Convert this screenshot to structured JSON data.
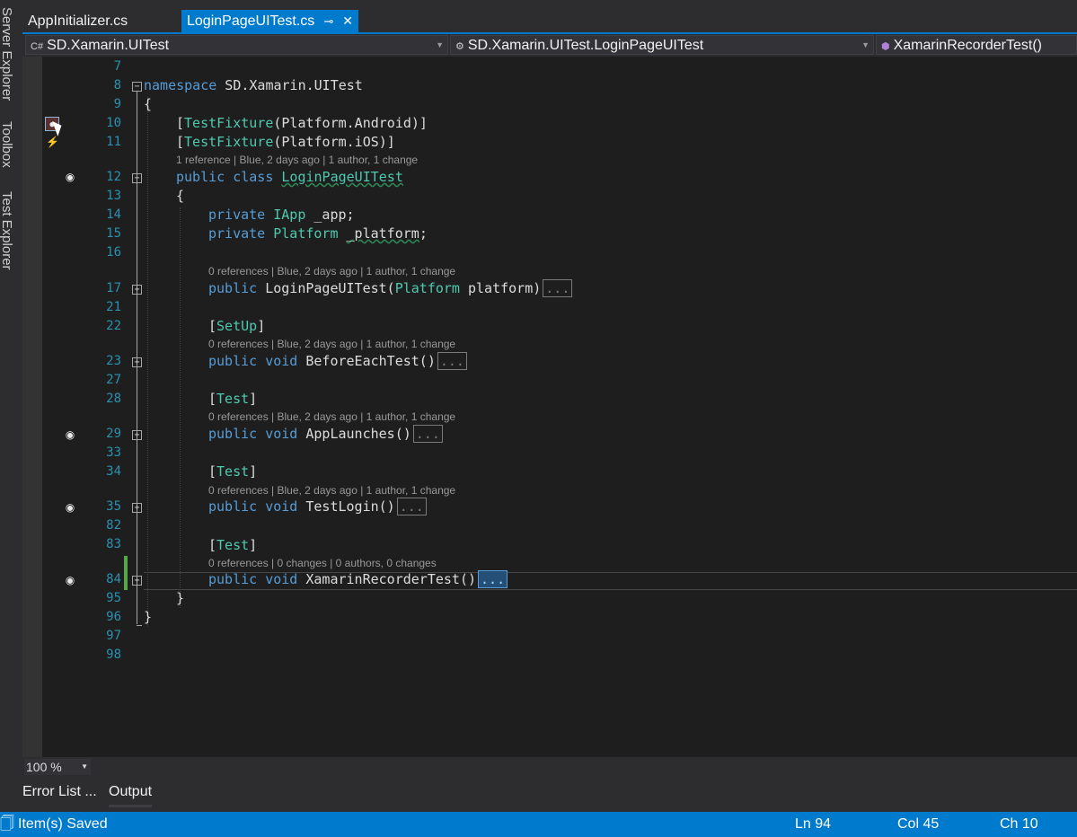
{
  "side_panels": [
    "Server Explorer",
    "Toolbox",
    "Test Explorer"
  ],
  "tabs": [
    {
      "label": "AppInitializer.cs"
    },
    {
      "label": "LoginPageUITest.cs",
      "pin": "⊸",
      "close": "✕"
    }
  ],
  "nav": {
    "project": "SD.Xamarin.UITest",
    "project_icon": "C#",
    "class": "SD.Xamarin.UITest.LoginPageUITest",
    "member": "XamarinRecorderTest()"
  },
  "lines": [
    "7",
    "8",
    "9",
    "10",
    "11",
    "12",
    "13",
    "14",
    "15",
    "16",
    "17",
    "21",
    "22",
    "23",
    "27",
    "28",
    "29",
    "33",
    "34",
    "35",
    "82",
    "83",
    "84",
    "95",
    "96",
    "97",
    "98"
  ],
  "code": {
    "ns_kw": "namespace",
    "ns_name": " SD.Xamarin.UITest",
    "brace_open": "{",
    "attr1_open": "[",
    "attr1_name": "TestFixture",
    "attr1_arg": "(Platform.Android)]",
    "attr2_open": "[",
    "attr2_name": "TestFixture",
    "attr2_arg": "(Platform.iOS)]",
    "class_kw": "public class ",
    "class_name": "LoginPageUITest",
    "class_brace": "{",
    "f1_kw": "private ",
    "f1_type": "IApp",
    "f1_name": " _app;",
    "f2_kw": "private ",
    "f2_type": "Platform",
    "f2_space": " ",
    "f2_name": "_platform",
    "f2_semi": ";",
    "ctor_kw": "public ",
    "ctor_name": "LoginPageUITest(",
    "ctor_type": "Platform",
    "ctor_arg": " platform)",
    "setup_open": "[",
    "setup_attr": "SetUp",
    "setup_close": "]",
    "m1_kw": "public void ",
    "m1_name": "BeforeEachTest()",
    "test1_open": "[",
    "test1_attr": "Test",
    "test1_close": "]",
    "m2_kw": "public void ",
    "m2_name": "AppLaunches()",
    "test2_open": "[",
    "test2_attr": "Test",
    "test2_close": "]",
    "m3_kw": "public void ",
    "m3_name": "TestLogin()",
    "test3_open": "[",
    "test3_attr": "Test",
    "test3_close": "]",
    "m4_kw": "public void ",
    "m4_name": "XamarinRecorderTest()",
    "class_end": "}",
    "ns_end": "}",
    "collapsed": "..."
  },
  "codelens": {
    "class": "1 reference | Blue, 2 days ago | 1 author, 1 change",
    "ctor": "0 references | Blue, 2 days ago | 1 author, 1 change",
    "setup": "0 references | Blue, 2 days ago | 1 author, 1 change",
    "test1": "0 references | Blue, 2 days ago | 1 author, 1 change",
    "test2": "0 references | Blue, 2 days ago | 1 author, 1 change",
    "test3": "0 references | 0 changes | 0 authors, 0 changes"
  },
  "zoom": "100 %",
  "bottom_tabs": [
    "Error List ...",
    "Output"
  ],
  "status": {
    "icon": "🗍",
    "message": "Item(s) Saved",
    "ln": "Ln 94",
    "col": "Col 45",
    "ch": "Ch 10"
  },
  "colors": {
    "accent": "#007acc",
    "editor_bg": "#1e1e1e",
    "keyword": "#569cd6",
    "type": "#4ec9b0",
    "line_number": "#2b91af"
  }
}
